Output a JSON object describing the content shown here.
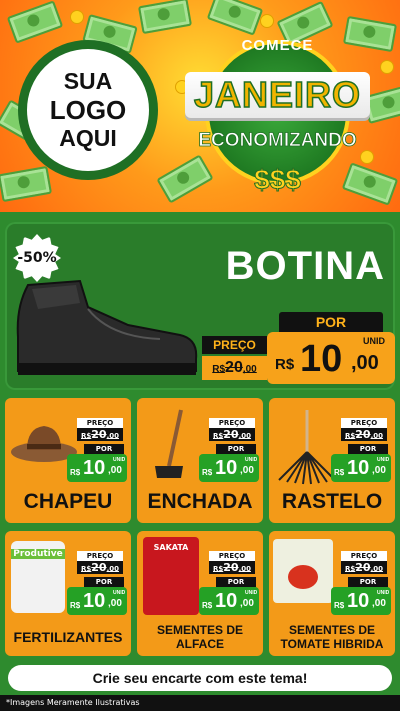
{
  "header": {
    "logo_lines": [
      "SUA",
      "LOGO",
      "AQUI"
    ],
    "badge": {
      "comece": "COMECE",
      "janeiro": "JANEIRO",
      "economizando": "ECONOMIZANDO",
      "money": "$$$"
    }
  },
  "featured": {
    "discount": "-50%",
    "title": "BOTINA",
    "preco_label": "PREÇO",
    "old_price": {
      "currency": "R$",
      "int": "20",
      "dec": ",00"
    },
    "por_label": "POR",
    "new_price": {
      "currency": "R$",
      "int": "10",
      "dec": ",00",
      "unit": "UNID"
    }
  },
  "products": [
    {
      "name": "CHAPEU",
      "preco_label": "PREÇO",
      "old": {
        "currency": "R$",
        "int": "20",
        "dec": ",00"
      },
      "por": "POR",
      "new": {
        "currency": "R$",
        "int": "10",
        "dec": ",00",
        "unit": "UNID"
      }
    },
    {
      "name": "ENCHADA",
      "preco_label": "PREÇO",
      "old": {
        "currency": "R$",
        "int": "20",
        "dec": ",00"
      },
      "por": "POR",
      "new": {
        "currency": "R$",
        "int": "10",
        "dec": ",00",
        "unit": "UNID"
      }
    },
    {
      "name": "RASTELO",
      "preco_label": "PREÇO",
      "old": {
        "currency": "R$",
        "int": "20",
        "dec": ",00"
      },
      "por": "POR",
      "new": {
        "currency": "R$",
        "int": "10",
        "dec": ",00",
        "unit": "UNID"
      }
    },
    {
      "name": "FERTILIZANTES",
      "preco_label": "PREÇO",
      "old": {
        "currency": "R$",
        "int": "20",
        "dec": ",00"
      },
      "por": "POR",
      "new": {
        "currency": "R$",
        "int": "10",
        "dec": ",00",
        "unit": "UNID"
      },
      "package_label": "Produtive"
    },
    {
      "name": "SEMENTES DE ALFACE",
      "preco_label": "PREÇO",
      "old": {
        "currency": "R$",
        "int": "20",
        "dec": ",00"
      },
      "por": "POR",
      "new": {
        "currency": "R$",
        "int": "10",
        "dec": ",00",
        "unit": "UNID"
      },
      "package_label": "SAKATA"
    },
    {
      "name": "SEMENTES DE TOMATE HIBRIDA",
      "preco_label": "PREÇO",
      "old": {
        "currency": "R$",
        "int": "20",
        "dec": ",00"
      },
      "por": "POR",
      "new": {
        "currency": "R$",
        "int": "10",
        "dec": ",00",
        "unit": "UNID"
      }
    }
  ],
  "cta": "Crie seu encarte com este tema!",
  "disclaimer": "*Imagens Meramente Ilustrativas",
  "colors": {
    "green": "#2a7d2a",
    "orange": "#f39a18",
    "price_green": "#25a125",
    "gold": "#ffd21f"
  }
}
